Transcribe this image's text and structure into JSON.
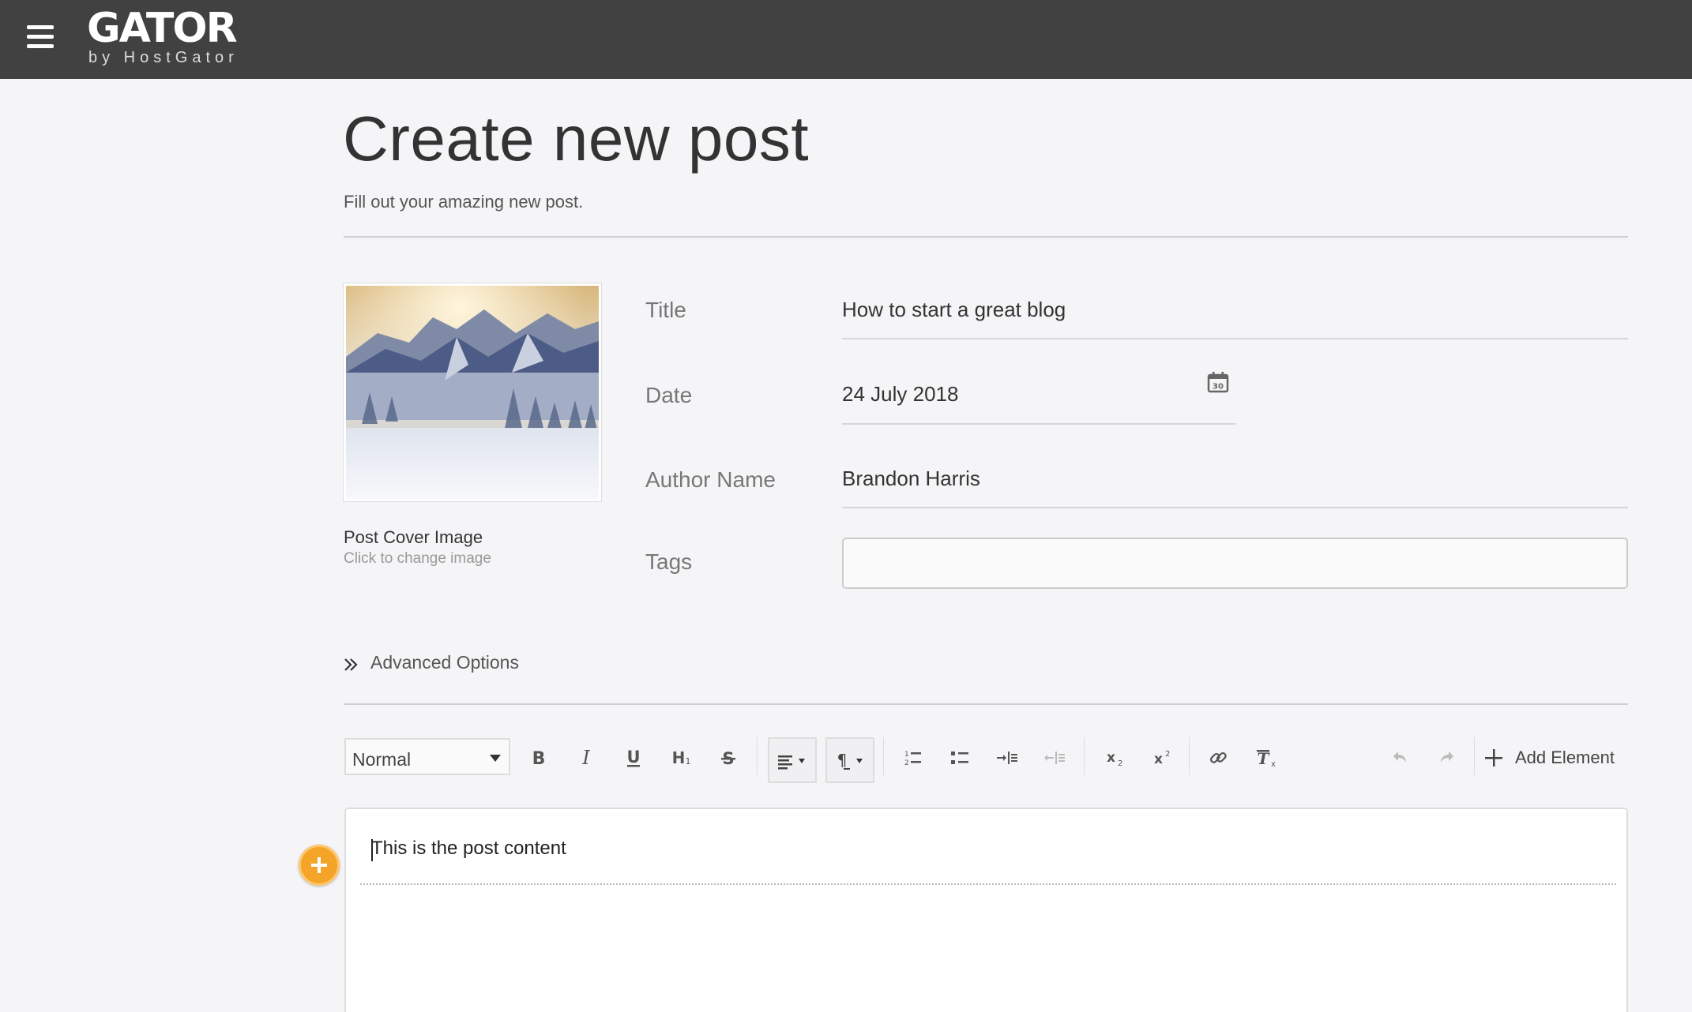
{
  "header": {
    "logo_main": "GATOR",
    "logo_sub": "by HostGator",
    "bg_color": "#414141"
  },
  "page": {
    "title": "Create new post",
    "subtitle": "Fill out your amazing new post."
  },
  "cover": {
    "label": "Post Cover Image",
    "hint": "Click to change image"
  },
  "form": {
    "title_label": "Title",
    "title_value": "How to start a great blog",
    "date_label": "Date",
    "date_value": "24 July 2018",
    "calendar_day": "30",
    "author_label": "Author Name",
    "author_value": "Brandon Harris",
    "tags_label": "Tags",
    "tags_value": ""
  },
  "advanced": {
    "label": "Advanced Options"
  },
  "toolbar": {
    "format_select": "Normal",
    "add_element_label": "Add Element",
    "icons": [
      "bold-icon",
      "italic-icon",
      "underline-icon",
      "heading-icon",
      "strikethrough-icon",
      "align-left-icon",
      "paragraph-direction-icon",
      "ordered-list-icon",
      "unordered-list-icon",
      "indent-icon",
      "outdent-icon",
      "subscript-icon",
      "superscript-icon",
      "link-icon",
      "clear-format-icon",
      "undo-icon",
      "redo-icon",
      "plus-icon"
    ]
  },
  "editor": {
    "content": "This is the post content"
  },
  "colors": {
    "accent_orange": "#f5a42a",
    "background": "#f5f5f7"
  }
}
